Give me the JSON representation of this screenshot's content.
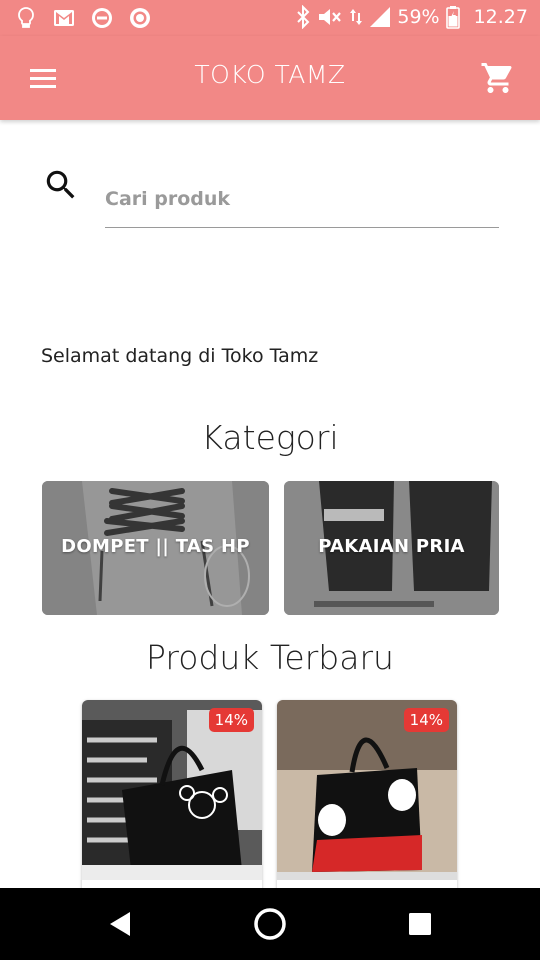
{
  "status_bar": {
    "battery": "59%",
    "time": "12.27",
    "icons": [
      "lightbulb-icon",
      "gmail-icon",
      "block-icon",
      "circle-app-icon",
      "bluetooth-icon",
      "mute-icon",
      "data-arrows-icon",
      "signal-icon",
      "battery-icon"
    ]
  },
  "app_bar": {
    "title": "TOKO TAMZ",
    "menu_icon": "hamburger-icon",
    "cart_icon": "cart-icon",
    "color": "#f28886"
  },
  "search": {
    "placeholder": "Cari produk",
    "value": ""
  },
  "welcome_text": "Selamat datang di Toko Tamz",
  "categories_section": {
    "title": "Kategori",
    "items": [
      {
        "label": "DOMPET || TAS HP"
      },
      {
        "label": "PAKAIAN PRIA"
      }
    ]
  },
  "products_section": {
    "title": "Produk Terbaru",
    "items": [
      {
        "discount": "14%"
      },
      {
        "discount": "14%"
      }
    ]
  },
  "nav_bar": {
    "buttons": [
      "back-icon",
      "home-icon",
      "recents-icon"
    ]
  }
}
